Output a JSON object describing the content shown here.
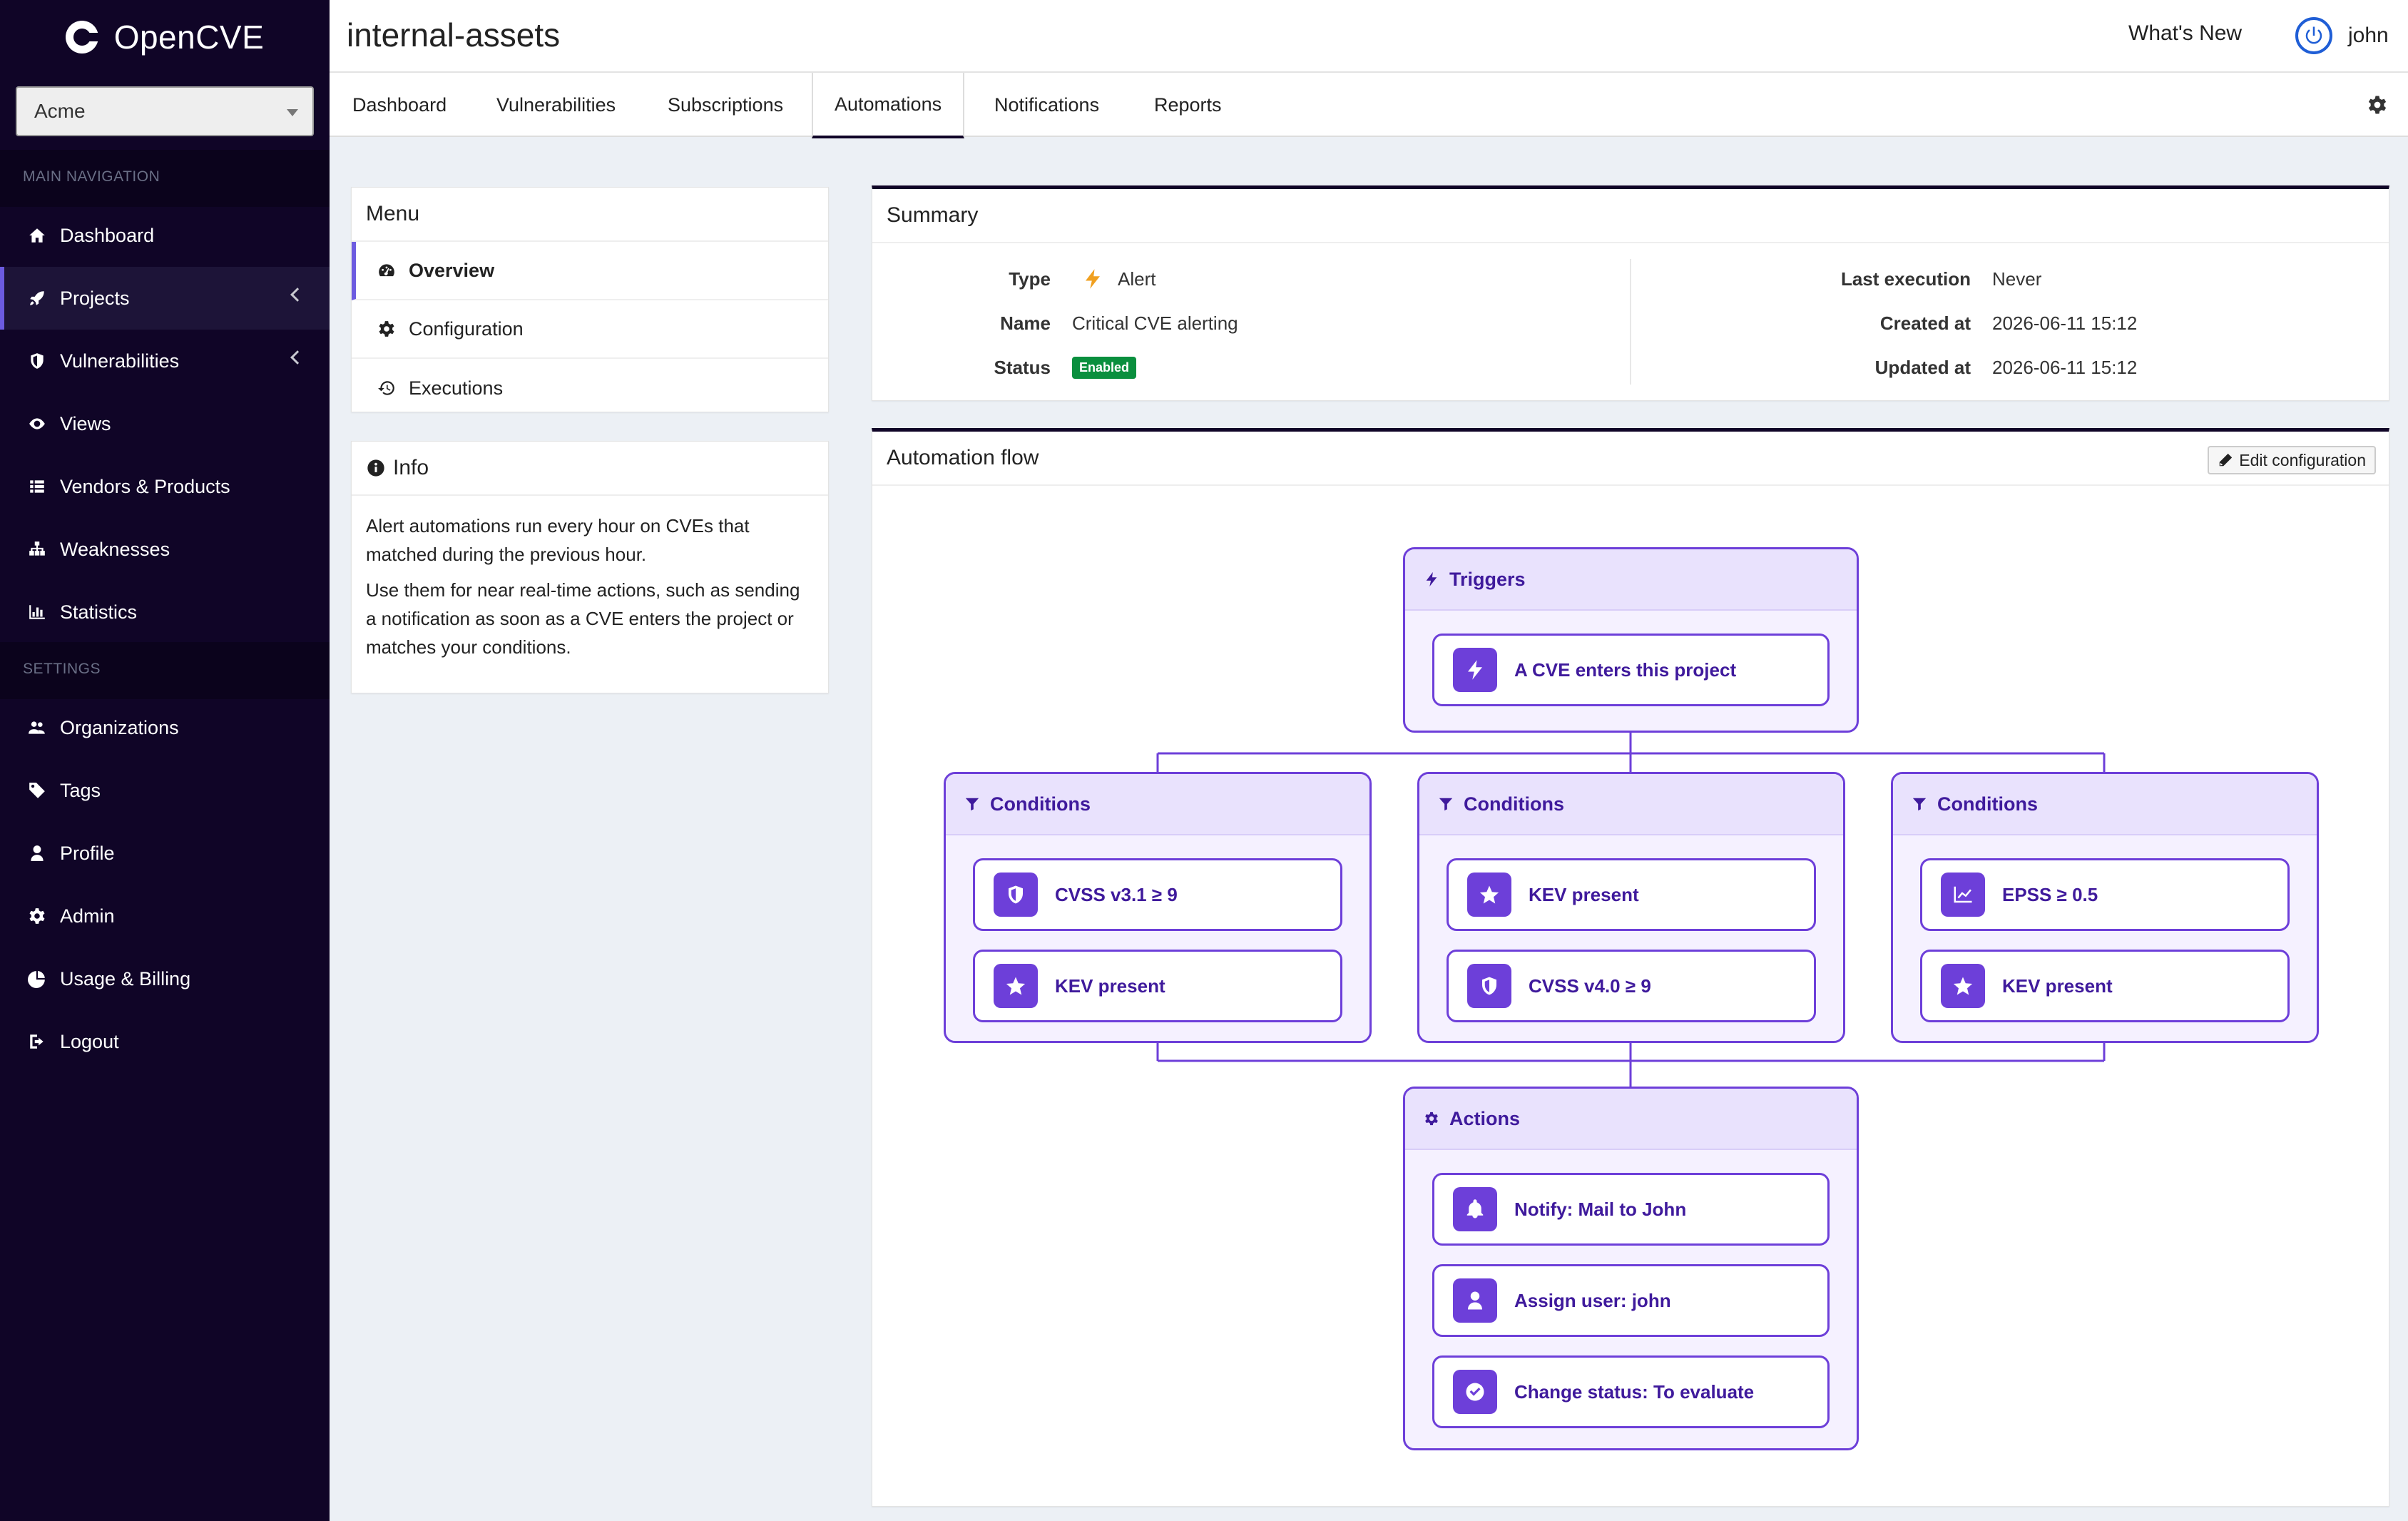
{
  "app": {
    "name": "OpenCVE"
  },
  "sidebar": {
    "org_selected": "Acme",
    "main_header": "MAIN NAVIGATION",
    "settings_header": "SETTINGS",
    "main_items": [
      {
        "label": "Dashboard",
        "icon": "home-icon"
      },
      {
        "label": "Projects",
        "icon": "rocket-icon"
      },
      {
        "label": "Vulnerabilities",
        "icon": "shield-icon"
      },
      {
        "label": "Views",
        "icon": "eye-icon"
      },
      {
        "label": "Vendors & Products",
        "icon": "list-icon"
      },
      {
        "label": "Weaknesses",
        "icon": "sitemap-icon"
      },
      {
        "label": "Statistics",
        "icon": "bar-chart-icon"
      }
    ],
    "settings_items": [
      {
        "label": "Organizations",
        "icon": "users-icon"
      },
      {
        "label": "Tags",
        "icon": "tags-icon"
      },
      {
        "label": "Profile",
        "icon": "user-icon"
      },
      {
        "label": "Admin",
        "icon": "gear-icon"
      },
      {
        "label": "Usage & Billing",
        "icon": "pie-chart-icon"
      },
      {
        "label": "Logout",
        "icon": "sign-out-icon"
      }
    ]
  },
  "header": {
    "title": "internal-assets",
    "whats_new": "What's New",
    "username": "john"
  },
  "tabs": [
    "Dashboard",
    "Vulnerabilities",
    "Subscriptions",
    "Automations",
    "Notifications",
    "Reports"
  ],
  "menu": {
    "title": "Menu",
    "items": [
      "Overview",
      "Configuration",
      "Executions"
    ]
  },
  "info": {
    "title": "Info",
    "p1": "Alert automations run every hour on CVEs that matched during the previous hour.",
    "p2": "Use them for near real-time actions, such as sending a notification as soon as a CVE enters the project or matches your conditions."
  },
  "summary": {
    "title": "Summary",
    "type_label": "Type",
    "type_value": "Alert",
    "name_label": "Name",
    "name_value": "Critical CVE alerting",
    "status_label": "Status",
    "status_value": "Enabled",
    "last_exec_label": "Last execution",
    "last_exec_value": "Never",
    "created_label": "Created at",
    "created_value": "2026-06-11 15:12",
    "updated_label": "Updated at",
    "updated_value": "2026-06-11 15:12"
  },
  "flow": {
    "title": "Automation flow",
    "edit_label": "Edit configuration",
    "triggers": {
      "title": "Triggers",
      "items": [
        {
          "label": "A CVE enters this project",
          "icon": "bolt-icon"
        }
      ]
    },
    "conditions": [
      {
        "title": "Conditions",
        "items": [
          {
            "label": "CVSS v3.1 ≥ 9",
            "icon": "shield-icon"
          },
          {
            "label": "KEV present",
            "icon": "star-icon"
          }
        ]
      },
      {
        "title": "Conditions",
        "items": [
          {
            "label": "KEV present",
            "icon": "star-icon"
          },
          {
            "label": "CVSS v4.0 ≥ 9",
            "icon": "shield-icon"
          }
        ]
      },
      {
        "title": "Conditions",
        "items": [
          {
            "label": "EPSS ≥ 0.5",
            "icon": "line-chart-icon"
          },
          {
            "label": "KEV present",
            "icon": "star-icon"
          }
        ]
      }
    ],
    "actions": {
      "title": "Actions",
      "items": [
        {
          "label": "Notify: Mail to John",
          "icon": "bell-icon"
        },
        {
          "label": "Assign user: john",
          "icon": "user-icon"
        },
        {
          "label": "Change status: To evaluate",
          "icon": "check-circle-icon"
        }
      ]
    }
  },
  "colors": {
    "sidebar_bg": "#100527",
    "accent": "#6d3fd9",
    "enabled_badge": "#0a8f3e",
    "alert_bolt": "#f0a020"
  }
}
